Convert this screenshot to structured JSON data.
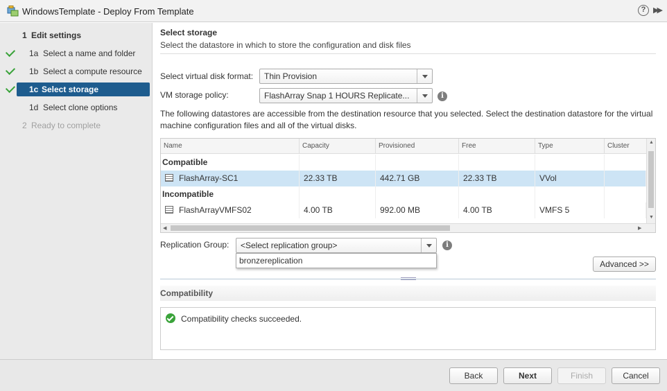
{
  "window": {
    "title": "WindowsTemplate - Deploy From Template",
    "icons": [
      "vm-template-icon",
      "help-icon",
      "expand-icon"
    ]
  },
  "sidebar": {
    "steps": [
      {
        "num": "1",
        "label": "Edit settings",
        "state": "section"
      },
      {
        "num": "1a",
        "label": "Select a name and folder",
        "state": "done"
      },
      {
        "num": "1b",
        "label": "Select a compute resource",
        "state": "done"
      },
      {
        "num": "1c",
        "label": "Select storage",
        "state": "current"
      },
      {
        "num": "1d",
        "label": "Select clone options",
        "state": "pending"
      },
      {
        "num": "2",
        "label": "Ready to complete",
        "state": "disabled"
      }
    ]
  },
  "main": {
    "title": "Select storage",
    "description": "Select the datastore in which to store the configuration and disk files",
    "disk_format": {
      "label": "Select virtual disk format:",
      "value": "Thin Provision"
    },
    "storage_policy": {
      "label": "VM storage policy:",
      "value": "FlashArray Snap 1 HOURS Replicate..."
    },
    "paragraph": "The following datastores are accessible from the destination resource that you selected. Select the destination datastore for the virtual machine configuration files and all of the virtual disks.",
    "table": {
      "columns": [
        "Name",
        "Capacity",
        "Provisioned",
        "Free",
        "Type",
        "Cluster"
      ],
      "groups": [
        {
          "label": "Compatible",
          "rows": [
            {
              "name": "FlashArray-SC1",
              "capacity": "22.33 TB",
              "provisioned": "442.71 GB",
              "free": "22.33 TB",
              "type": "VVol",
              "cluster": "",
              "selected": true
            }
          ]
        },
        {
          "label": "Incompatible",
          "rows": [
            {
              "name": "FlashArrayVMFS02",
              "capacity": "4.00 TB",
              "provisioned": "992.00 MB",
              "free": "4.00 TB",
              "type": "VMFS 5",
              "cluster": "",
              "selected": false
            }
          ]
        }
      ]
    },
    "replication_group": {
      "label": "Replication Group:",
      "value": "<Select replication group>",
      "options": [
        "bronzereplication"
      ]
    },
    "advanced_button": "Advanced >>",
    "compatibility": {
      "header": "Compatibility",
      "message": "Compatibility checks succeeded."
    }
  },
  "footer": {
    "back": "Back",
    "next": "Next",
    "finish": "Finish",
    "cancel": "Cancel"
  },
  "colors": {
    "selected_step_bg": "#1e5c8e",
    "selected_row_bg": "#cde4f5",
    "check_green": "#3aa33a"
  }
}
